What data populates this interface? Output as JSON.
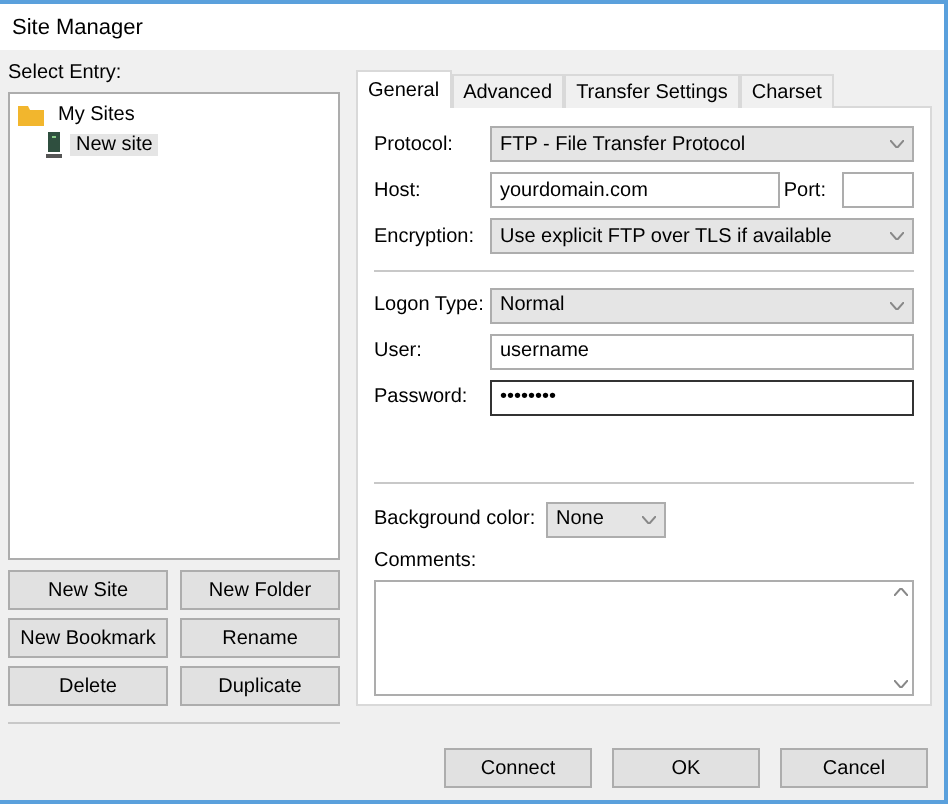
{
  "window": {
    "title": "Site Manager"
  },
  "entries": {
    "label": "Select Entry:",
    "tree": [
      {
        "label": "My Sites",
        "kind": "folder",
        "selected": false,
        "children": [
          {
            "label": "New site",
            "kind": "site",
            "selected": true
          }
        ]
      }
    ]
  },
  "entry_buttons": [
    "New Site",
    "New Folder",
    "New Bookmark",
    "Rename",
    "Delete",
    "Duplicate"
  ],
  "tabs": [
    {
      "label": "General",
      "selected": true
    },
    {
      "label": "Advanced",
      "selected": false
    },
    {
      "label": "Transfer Settings",
      "selected": false
    },
    {
      "label": "Charset",
      "selected": false
    }
  ],
  "general": {
    "protocol": {
      "label": "Protocol:",
      "value": "FTP - File Transfer Protocol"
    },
    "host": {
      "label": "Host:",
      "value": "yourdomain.com"
    },
    "port": {
      "label": "Port:"
    },
    "encryption": {
      "label": "Encryption:",
      "value": "Use explicit FTP over TLS if available"
    },
    "logon_type": {
      "label": "Logon Type:",
      "value": "Normal"
    },
    "user": {
      "label": "User:",
      "value": "username"
    },
    "password": {
      "label": "Password:",
      "value": "••••••••"
    },
    "background_color": {
      "label": "Background color:",
      "value": "None"
    },
    "comments": {
      "label": "Comments:"
    }
  },
  "buttons": [
    "Connect",
    "OK",
    "Cancel"
  ]
}
